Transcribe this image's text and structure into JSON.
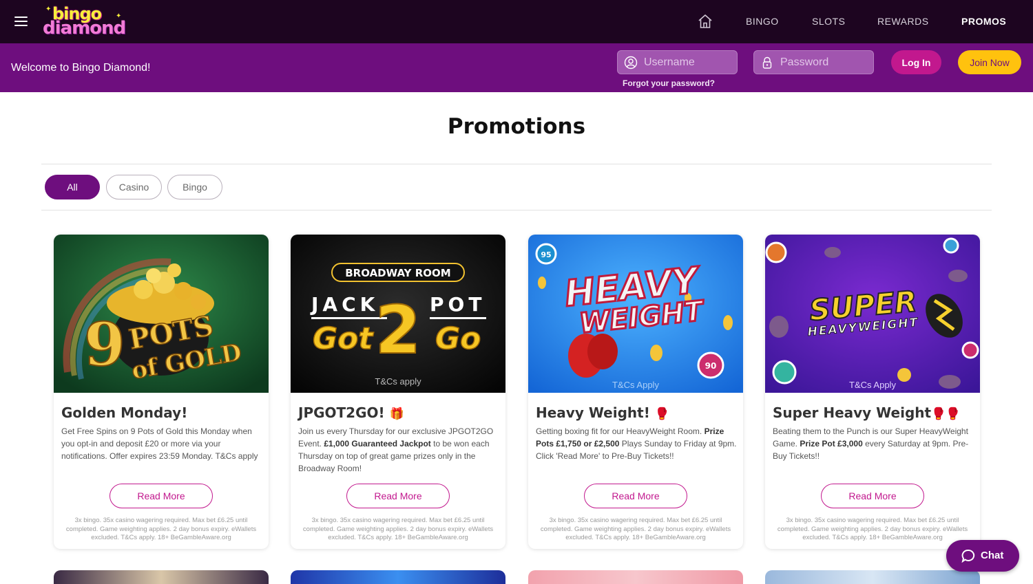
{
  "header": {
    "logo_top": "bingo",
    "logo_bottom": "diamond",
    "nav": [
      {
        "label": "BINGO"
      },
      {
        "label": "SLOTS"
      },
      {
        "label": "REWARDS"
      },
      {
        "label": "PROMOS",
        "active": true
      }
    ]
  },
  "loginbar": {
    "welcome": "Welcome to Bingo Diamond!",
    "username_placeholder": "Username",
    "password_placeholder": "Password",
    "forgot": "Forgot your password?",
    "login_label": "Log In",
    "join_label": "Join Now"
  },
  "page": {
    "title": "Promotions",
    "filters": [
      {
        "label": "All",
        "active": true
      },
      {
        "label": "Casino"
      },
      {
        "label": "Bingo"
      }
    ]
  },
  "cards": [
    {
      "title": "Golden Monday!",
      "banner_top": "9",
      "banner_main": "POTS",
      "banner_sub": "of GOLD",
      "desc": "Get Free Spins on 9 Pots of Gold this Monday when you opt-in and deposit £20 or more via your notifications. Offer expires 23:59 Monday. T&Cs apply",
      "button": "Read More",
      "terms": "3x bingo. 35x casino wagering required. Max bet £6.25 until completed. Game weighting applies. 2 day bonus expiry. eWallets excluded. T&Cs apply. 18+ BeGambleAware.org"
    },
    {
      "title": "JPGOT2GO!",
      "title_icon": "🎁",
      "banner_room": "BROADWAY ROOM",
      "banner_jack": "JACK",
      "banner_pot": "POT",
      "banner_got": "Got",
      "banner_two": "2",
      "banner_go": "Go",
      "banner_tc": "T&Cs apply",
      "desc_a": "Join us every Thursday for our exclusive JPGOT2GO Event. ",
      "desc_b": "£1,000 Guaranteed Jackpot",
      "desc_c": " to be won each Thursday on top of great game prizes only in the Broadway Room!",
      "button": "Read More",
      "terms": "3x bingo. 35x casino wagering required. Max bet £6.25 until completed. Game weighting applies. 2 day bonus expiry. eWallets excluded. T&Cs apply. 18+ BeGambleAware.org"
    },
    {
      "title": "Heavy Weight!",
      "title_icon": "🥊",
      "banner_l1": "HEAVY",
      "banner_l2": "WEIGHT",
      "banner_tc": "T&Cs Apply",
      "ball_a": "90",
      "ball_b": "95",
      "desc_a": "Getting boxing fit for our HeavyWeight Room. ",
      "desc_b": "Prize Pots £1,750 or £2,500",
      "desc_c": " Plays Sunday to Friday at 9pm. Click 'Read More' to Pre-Buy Tickets!!",
      "button": "Read More",
      "terms": "3x bingo. 35x casino wagering required. Max bet £6.25 until completed. Game weighting applies. 2 day bonus expiry. eWallets excluded. T&Cs apply. 18+ BeGambleAware.org"
    },
    {
      "title": "Super Heavy Weight",
      "title_icon": "🥊🥊",
      "banner_l1": "SUPER",
      "banner_l2": "HEAVYWEIGHT",
      "banner_tc": "T&Cs Apply",
      "desc_a": "Beating them to the Punch is our Super HeavyWeight Game. ",
      "desc_b": "Prize Pot £3,000",
      "desc_c": " every Saturday at 9pm. Pre-Buy Tickets!!",
      "button": "Read More",
      "terms": "3x bingo. 35x casino wagering required. Max bet £6.25 until completed. Game weighting applies. 2 day bonus expiry. eWallets excluded. T&Cs apply. 18+ BeGambleAware.org"
    }
  ],
  "chat": {
    "label": "Chat"
  }
}
